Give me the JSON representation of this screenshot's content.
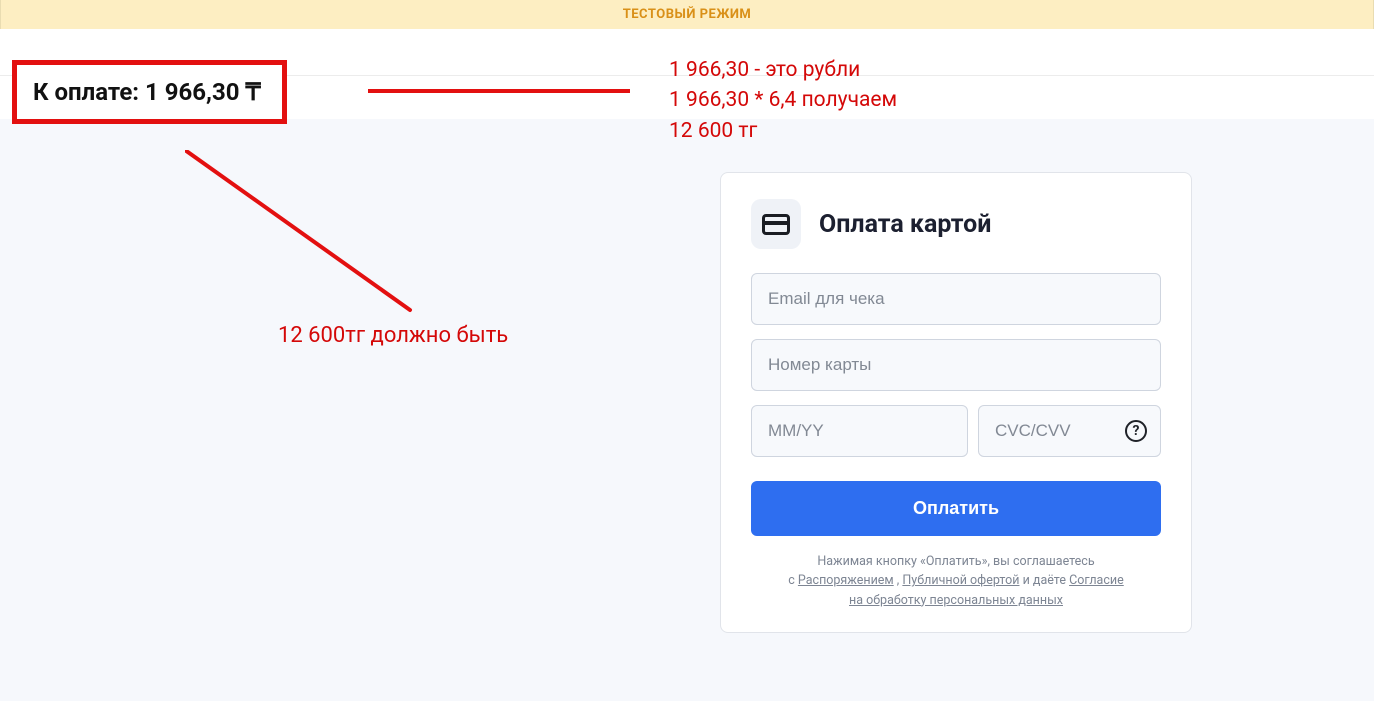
{
  "banner": {
    "text": "ТЕСТОВЫЙ РЕЖИМ"
  },
  "header": {
    "to_pay": "К оплате: 1 966,30 ₸"
  },
  "annotations": {
    "calc_line1": "1 966,30 - это рубли",
    "calc_line2": "1 966,30 * 6,4 получаем",
    "calc_line3": "12 600 тг",
    "should_be": "12 600тг должно быть"
  },
  "card": {
    "title": "Оплата картой",
    "email_placeholder": "Email для чека",
    "number_placeholder": "Номер карты",
    "expiry_placeholder": "MM/YY",
    "cvc_placeholder": "CVC/CVV",
    "pay_label": "Оплатить",
    "legal": {
      "line1_pre": "Нажимая кнопку «Оплатить», вы соглашаетесь",
      "line2_pre": "с ",
      "order_link": "Распоряжением",
      "sep1": " , ",
      "offer_link": "Публичной офертой",
      "line2_post": " и даёте ",
      "consent_link_1": "Согласие",
      "consent_link_2": "на обработку персональных данных"
    }
  }
}
